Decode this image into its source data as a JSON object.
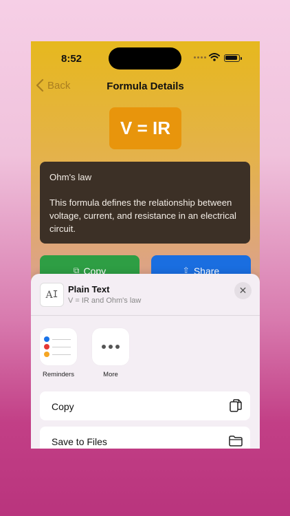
{
  "status": {
    "time": "8:52"
  },
  "nav": {
    "back_label": "Back",
    "title": "Formula Details"
  },
  "formula": {
    "text": "V = IR"
  },
  "description": {
    "name": "Ohm's law",
    "body": "This formula defines the relationship between voltage, current, and resistance in an electrical circuit."
  },
  "buttons": {
    "copy_label": "Copy",
    "share_label": "Share"
  },
  "share_sheet": {
    "title": "Plain Text",
    "subtitle": "V = IR and Ohm's law",
    "doc_icon_glyph": "A",
    "apps": [
      {
        "label": "Reminders",
        "icon": "reminders-icon"
      },
      {
        "label": "More",
        "icon": "more-icon"
      }
    ],
    "actions": [
      {
        "label": "Copy",
        "icon": "copy-icon"
      },
      {
        "label": "Save to Files",
        "icon": "folder-icon"
      }
    ]
  },
  "colors": {
    "formula_badge": "#e8950c",
    "copy_button": "#2e9e44",
    "share_button": "#1a6ee0",
    "description_bg": "#3c3026"
  }
}
